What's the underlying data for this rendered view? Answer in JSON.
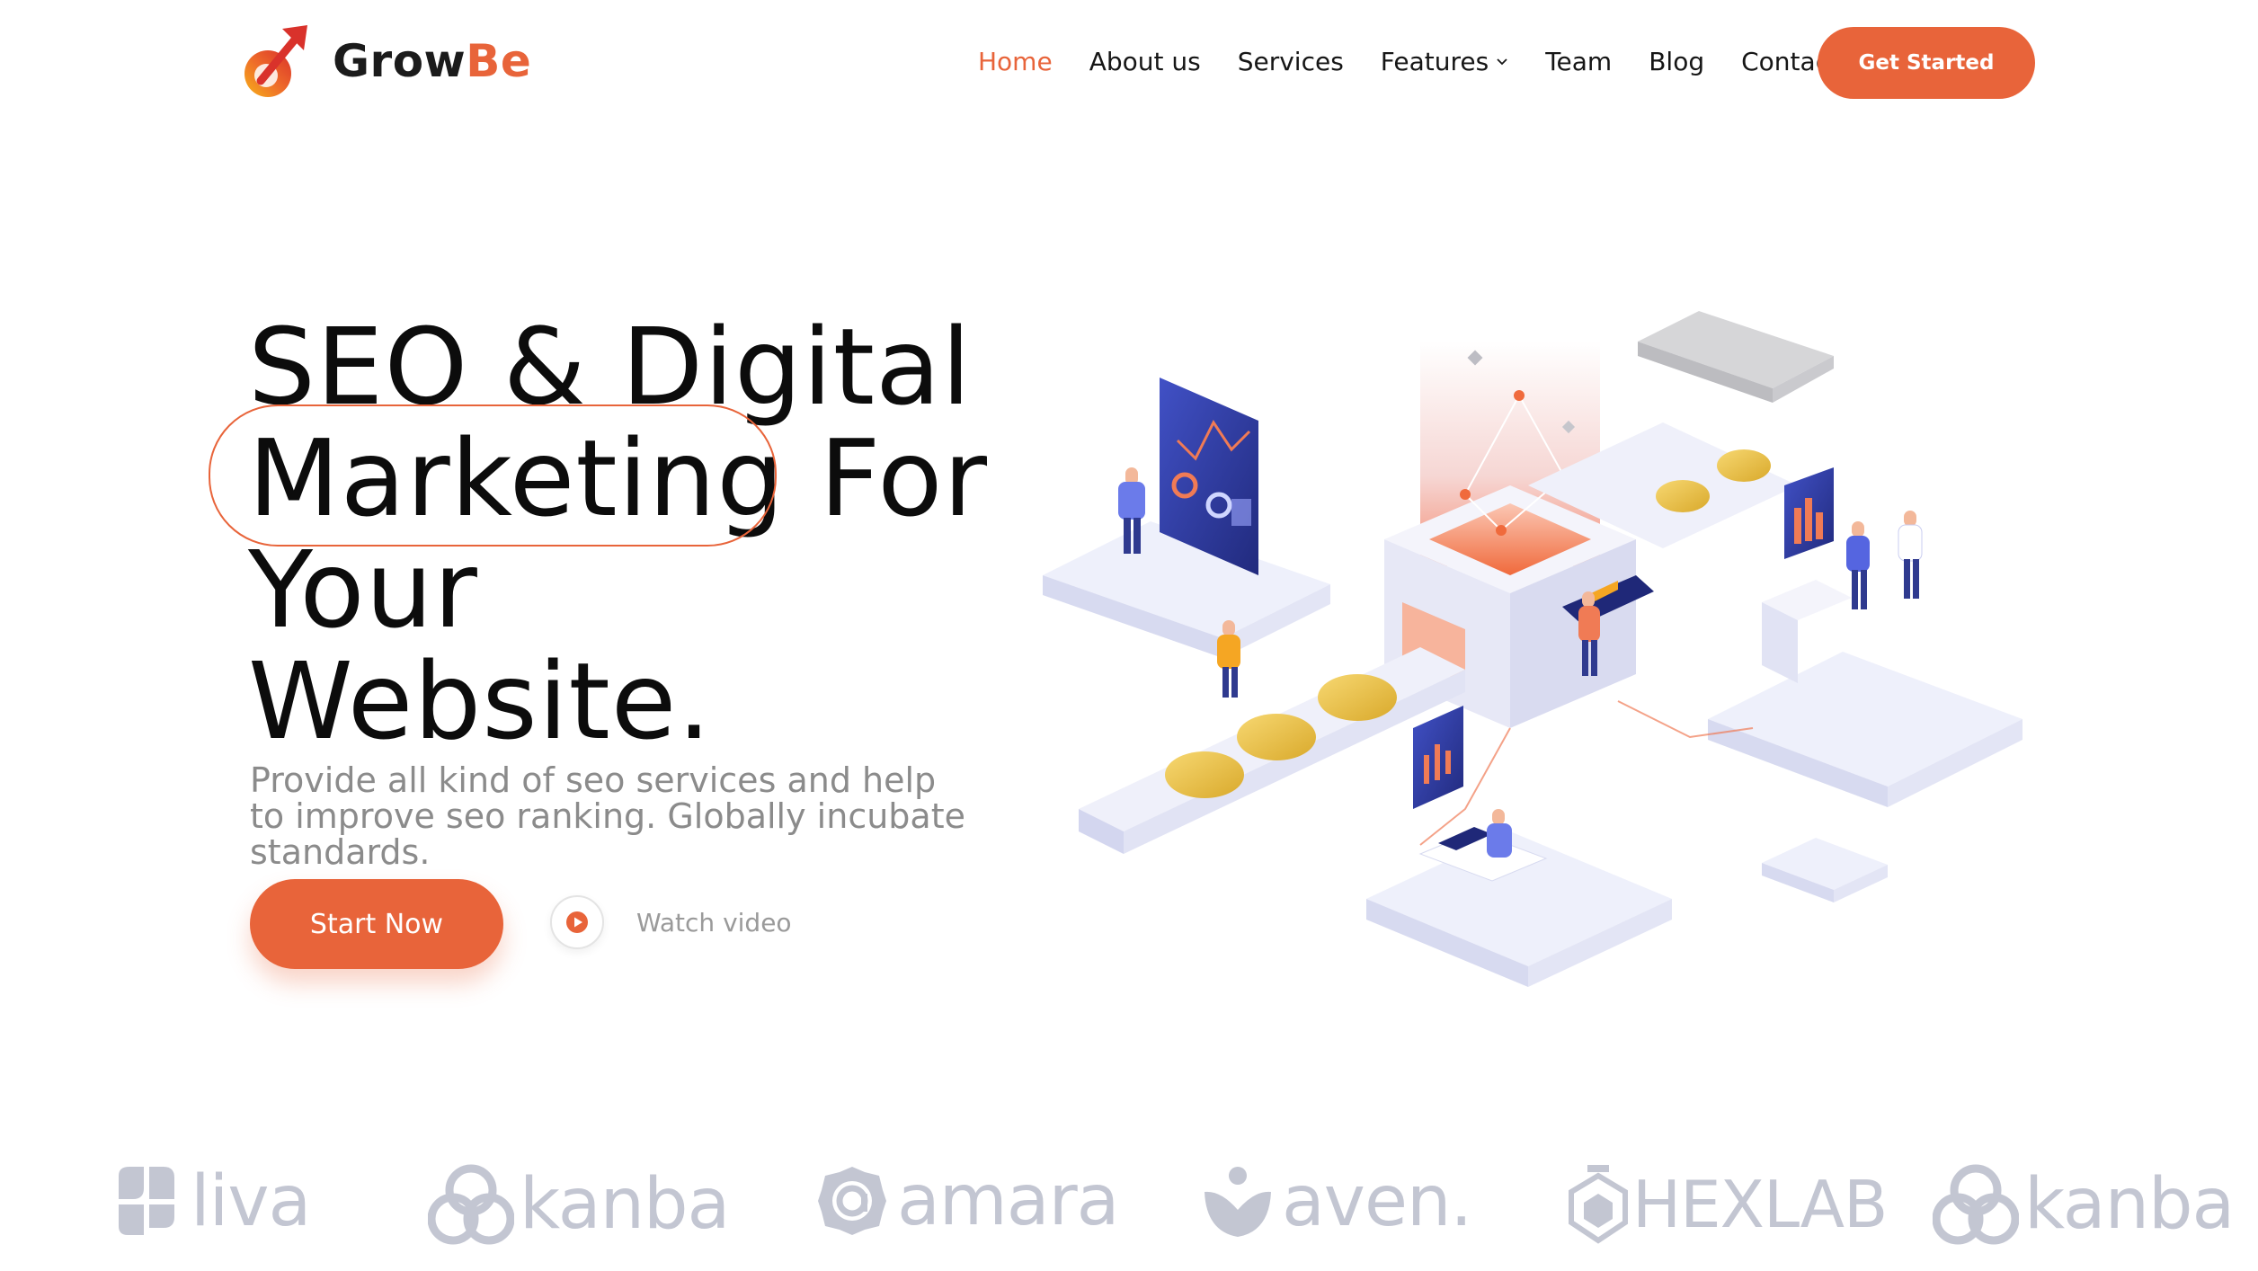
{
  "brand": {
    "name_part1": "Grow",
    "name_part2": "Be",
    "accent_color": "#e8643a"
  },
  "nav": {
    "items": [
      {
        "label": "Home",
        "active": true
      },
      {
        "label": "About us",
        "active": false
      },
      {
        "label": "Services",
        "active": false
      },
      {
        "label": "Features",
        "active": false,
        "has_dropdown": true
      },
      {
        "label": "Team",
        "active": false
      },
      {
        "label": "Blog",
        "active": false
      },
      {
        "label": "Contact",
        "active": false
      }
    ],
    "cta_label": "Get Started"
  },
  "hero": {
    "title_line1": "SEO & Digital",
    "title_highlight": "Marketing",
    "title_line2_rest": " For",
    "title_line3": "Your",
    "title_line4": "Website.",
    "subtitle": "Provide all kind of seo services and help to improve seo ranking. Globally incubate standards.",
    "primary_button": "Start Now",
    "video_link": "Watch video"
  },
  "partners": [
    {
      "name": "liva",
      "icon": "liva-logo-icon"
    },
    {
      "name": "kanba",
      "icon": "kanba-logo-icon"
    },
    {
      "name": "amara",
      "icon": "amara-logo-icon"
    },
    {
      "name": "aven.",
      "icon": "aven-logo-icon"
    },
    {
      "name": "HEXLAB",
      "icon": "hexlab-logo-icon"
    },
    {
      "name": "kanba",
      "icon": "kanba-logo-icon"
    }
  ],
  "icons": {
    "logo": "arrow-up-right-logo-icon",
    "dropdown": "chevron-down-icon",
    "play": "play-icon"
  }
}
